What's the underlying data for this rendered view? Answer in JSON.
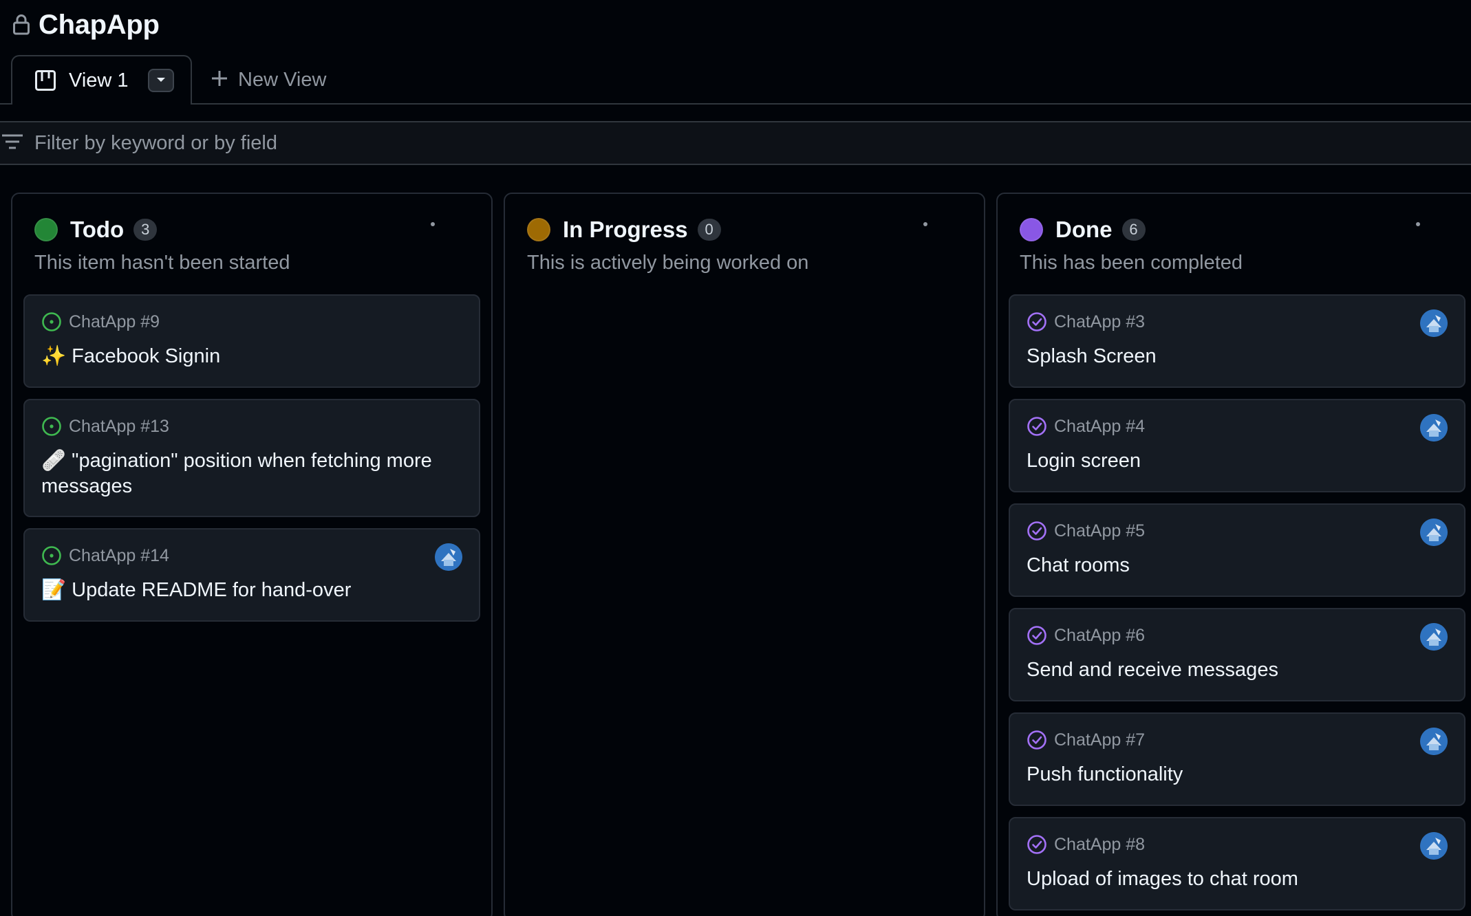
{
  "header": {
    "title": "ChapApp"
  },
  "tabs": {
    "active_label": "View 1",
    "new_view_label": "New View"
  },
  "filter": {
    "placeholder": "Filter by keyword or by field",
    "value": ""
  },
  "colors": {
    "todo": "#238636",
    "in_progress": "#9e6a03",
    "done": "#8957e5",
    "open_issue": "#3fb950",
    "closed_issue": "#a371f7"
  },
  "columns": [
    {
      "title": "Todo",
      "count": "3",
      "description": "This item hasn't been started",
      "cards": [
        {
          "ref": "ChatApp #9",
          "title": "✨ Facebook Signin",
          "assigned": false
        },
        {
          "ref": "ChatApp #13",
          "title": "🩹 \"pagination\" position when fetching more messages",
          "assigned": false
        },
        {
          "ref": "ChatApp #14",
          "title": "📝 Update README for hand-over",
          "assigned": true
        }
      ]
    },
    {
      "title": "In Progress",
      "count": "0",
      "description": "This is actively being worked on",
      "cards": []
    },
    {
      "title": "Done",
      "count": "6",
      "description": "This has been completed",
      "cards": [
        {
          "ref": "ChatApp #3",
          "title": "Splash Screen",
          "assigned": true
        },
        {
          "ref": "ChatApp #4",
          "title": "Login screen",
          "assigned": true
        },
        {
          "ref": "ChatApp #5",
          "title": "Chat rooms",
          "assigned": true
        },
        {
          "ref": "ChatApp #6",
          "title": "Send and receive messages",
          "assigned": true
        },
        {
          "ref": "ChatApp #7",
          "title": "Push functionality",
          "assigned": true
        },
        {
          "ref": "ChatApp #8",
          "title": "Upload of images to chat room",
          "assigned": true
        }
      ]
    }
  ]
}
